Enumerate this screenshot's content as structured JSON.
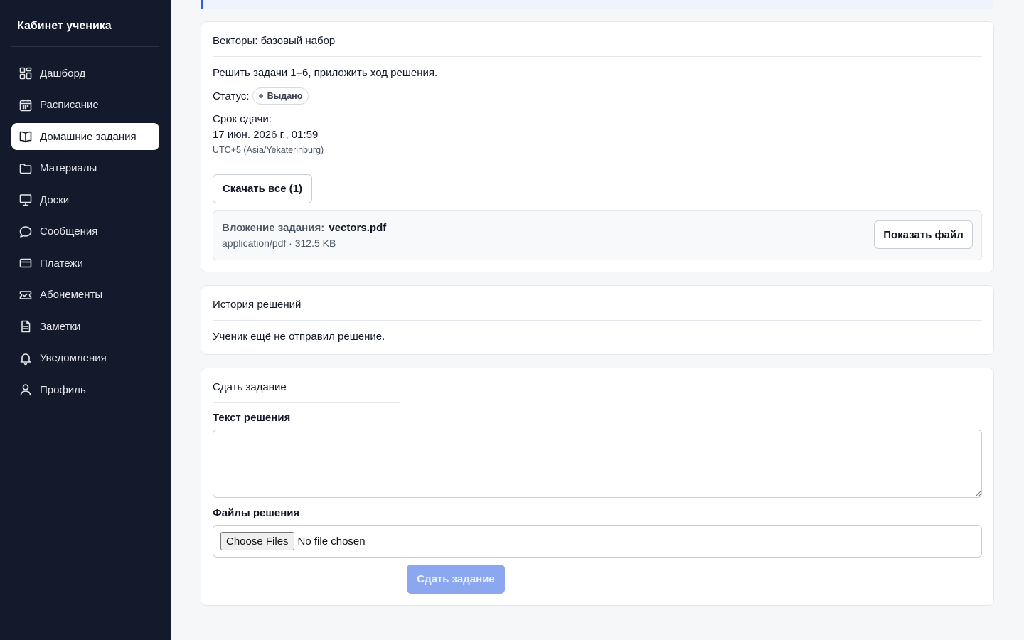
{
  "sidebar": {
    "title": "Кабинет ученика",
    "items": [
      {
        "label": "Дашборд",
        "icon": "dashboard-icon"
      },
      {
        "label": "Расписание",
        "icon": "calendar-icon"
      },
      {
        "label": "Домашние задания",
        "icon": "book-icon",
        "active": true
      },
      {
        "label": "Материалы",
        "icon": "folder-icon"
      },
      {
        "label": "Доски",
        "icon": "board-icon"
      },
      {
        "label": "Сообщения",
        "icon": "chat-icon"
      },
      {
        "label": "Платежи",
        "icon": "credit-card-icon"
      },
      {
        "label": "Абонементы",
        "icon": "ticket-icon"
      },
      {
        "label": "Заметки",
        "icon": "note-icon"
      },
      {
        "label": "Уведомления",
        "icon": "bell-icon"
      },
      {
        "label": "Профиль",
        "icon": "user-icon"
      }
    ]
  },
  "assignment": {
    "title": "Векторы: базовый набор",
    "description": "Решить задачи 1–6, приложить ход решения.",
    "status_label": "Статус:",
    "status_value": "Выдано",
    "due_label": "Срок сдачи:",
    "due_value": "17 июн. 2026 г., 01:59",
    "timezone": "UTC+5 (Asia/Yekaterinburg)",
    "download_all_label": "Скачать все (1)",
    "attachment": {
      "label": "Вложение задания:",
      "name": "vectors.pdf",
      "meta": "application/pdf · 312.5 KB",
      "show_label": "Показать файл"
    }
  },
  "history": {
    "title": "История решений",
    "empty_text": "Ученик ещё не отправил решение."
  },
  "submit": {
    "title": "Сдать задание",
    "text_label": "Текст решения",
    "text_value": "",
    "files_label": "Файлы решения",
    "choose_files_label": "Choose Files",
    "no_file_text": "No file chosen",
    "submit_label": "Сдать задание"
  },
  "colors": {
    "sidebar_bg": "#131a2b",
    "accent": "#2f5fd6",
    "submit_disabled": "#8aa7f0"
  }
}
